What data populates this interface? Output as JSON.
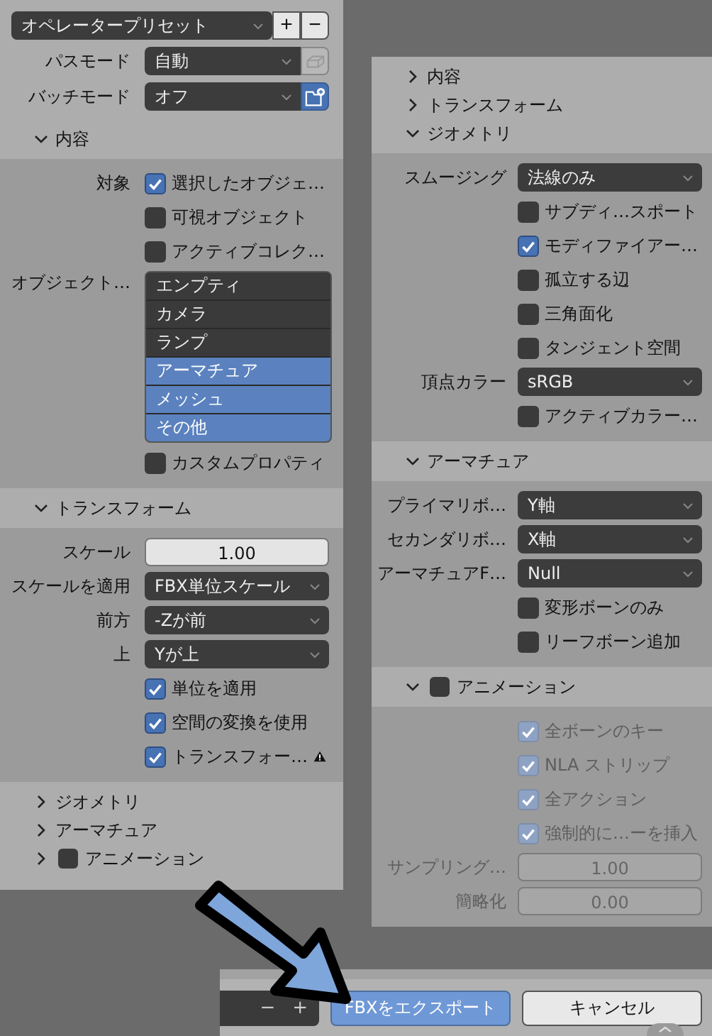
{
  "left_panel": {
    "preset": {
      "value": "オペレータープリセット",
      "add": "+",
      "remove": "−"
    },
    "rows": [
      {
        "label": "パスモード",
        "value": "自動",
        "toggle_on": false,
        "kind": "box"
      },
      {
        "label": "バッチモード",
        "value": "オフ",
        "toggle_on": true,
        "kind": "folder"
      }
    ],
    "sections": [
      {
        "title": "内容",
        "expanded": true,
        "disabled": false,
        "rows": [
          {
            "kind": "checkbox",
            "label": "対象",
            "text": "選択したオブジェ…",
            "checked": true
          },
          {
            "kind": "checkbox",
            "text": "可視オブジェクト",
            "checked": false
          },
          {
            "kind": "checkbox",
            "text": "アクティブコレク…",
            "checked": false
          },
          {
            "kind": "list",
            "label": "オブジェクト…",
            "items": [
              {
                "text": "エンプティ",
                "selected": false
              },
              {
                "text": "カメラ",
                "selected": false
              },
              {
                "text": "ランプ",
                "selected": false
              },
              {
                "text": "アーマチュア",
                "selected": true
              },
              {
                "text": "メッシュ",
                "selected": true
              },
              {
                "text": "その他",
                "selected": true
              }
            ]
          },
          {
            "kind": "checkbox",
            "text": "カスタムプロパティ",
            "checked": false
          }
        ]
      },
      {
        "title": "トランスフォーム",
        "expanded": true,
        "disabled": false,
        "rows": [
          {
            "kind": "number",
            "label": "スケール",
            "value": "1.00"
          },
          {
            "kind": "dropdown",
            "label": "スケールを適用",
            "value": "FBX単位スケール"
          },
          {
            "kind": "dropdown",
            "label": "前方",
            "value": "-Zが前"
          },
          {
            "kind": "dropdown",
            "label": "上",
            "value": "Yが上"
          },
          {
            "kind": "checkbox",
            "text": "単位を適用",
            "checked": true
          },
          {
            "kind": "checkbox",
            "text": "空間の変換を使用",
            "checked": true
          },
          {
            "kind": "checkbox",
            "text": "トランスフォー…",
            "checked": true,
            "warning": true
          }
        ]
      },
      {
        "title": "ジオメトリ",
        "expanded": false
      },
      {
        "title": "アーマチュア",
        "expanded": false
      },
      {
        "title": "アニメーション",
        "expanded": false,
        "enabled": false
      }
    ]
  },
  "right_panel": {
    "sections": [
      {
        "title": "内容",
        "expanded": false
      },
      {
        "title": "トランスフォーム",
        "expanded": false
      },
      {
        "title": "ジオメトリ",
        "expanded": true,
        "disabled": false,
        "rows": [
          {
            "kind": "dropdown",
            "label": "スムージング",
            "value": "法線のみ"
          },
          {
            "kind": "checkbox",
            "text": "サブディ…スポート",
            "checked": false
          },
          {
            "kind": "checkbox",
            "text": "モディファイアー…",
            "checked": true
          },
          {
            "kind": "checkbox",
            "text": "孤立する辺",
            "checked": false
          },
          {
            "kind": "checkbox",
            "text": "三角面化",
            "checked": false
          },
          {
            "kind": "checkbox",
            "text": "タンジェント空間",
            "checked": false
          },
          {
            "kind": "dropdown",
            "label": "頂点カラー",
            "value": "sRGB"
          },
          {
            "kind": "checkbox",
            "text": "アクティブカラー…",
            "checked": false
          }
        ]
      },
      {
        "title": "アーマチュア",
        "expanded": true,
        "disabled": false,
        "rows": [
          {
            "kind": "dropdown",
            "label": "プライマリボ…",
            "value": "Y軸"
          },
          {
            "kind": "dropdown",
            "label": "セカンダリボ…",
            "value": "X軸"
          },
          {
            "kind": "dropdown",
            "label": "アーマチュアF…",
            "value": "Null"
          },
          {
            "kind": "checkbox",
            "text": "変形ボーンのみ",
            "checked": false
          },
          {
            "kind": "checkbox",
            "text": "リーフボーン追加",
            "checked": false
          }
        ]
      },
      {
        "title": "アニメーション",
        "expanded": true,
        "enabled": false,
        "disabled": true,
        "rows": [
          {
            "kind": "checkbox",
            "text": "全ボーンのキー",
            "checked": true
          },
          {
            "kind": "checkbox",
            "text": "NLA ストリップ",
            "checked": true
          },
          {
            "kind": "checkbox",
            "text": "全アクション",
            "checked": true
          },
          {
            "kind": "checkbox",
            "text": "強制的に…ーを挿入",
            "checked": true
          },
          {
            "kind": "number",
            "label": "サンプリング…",
            "value": "1.00"
          },
          {
            "kind": "number",
            "label": "簡略化",
            "value": "0.00"
          }
        ]
      }
    ]
  },
  "footer": {
    "stepper": {
      "minus": "−",
      "plus": "+"
    },
    "buttons": [
      {
        "label": "FBXをエクスポート",
        "primary": true
      },
      {
        "label": "キャンセル",
        "primary": false
      }
    ]
  }
}
